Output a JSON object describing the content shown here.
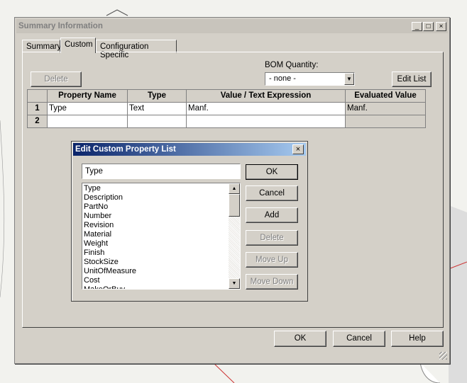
{
  "window": {
    "title": "Summary Information",
    "controls": {
      "minimize": "_",
      "maximize": "□",
      "close": "×"
    }
  },
  "tabs": [
    {
      "label": "Summary",
      "active": false
    },
    {
      "label": "Custom",
      "active": true
    },
    {
      "label": "Configuration Specific",
      "active": false
    }
  ],
  "toolbar": {
    "delete_label": "Delete",
    "bom_label": "BOM Quantity:",
    "bom_value": "- none -",
    "edit_list_label": "Edit List"
  },
  "grid": {
    "headers": [
      "Property Name",
      "Type",
      "Value / Text Expression",
      "Evaluated Value"
    ],
    "rows": [
      {
        "num": "1",
        "cells": [
          "Type",
          "Text",
          "Manf.",
          "Manf."
        ]
      },
      {
        "num": "2",
        "cells": [
          "",
          "",
          "",
          ""
        ]
      }
    ]
  },
  "dialog": {
    "title": "Edit Custom Property List",
    "close": "×",
    "input_value": "Type",
    "list_items": [
      "Type",
      "Description",
      "PartNo",
      "Number",
      "Revision",
      "Material",
      "Weight",
      "Finish",
      "StockSize",
      "UnitOfMeasure",
      "Cost",
      "MakeOrBuy"
    ],
    "buttons": {
      "ok": "OK",
      "cancel": "Cancel",
      "add": "Add",
      "delete": "Delete",
      "move_up": "Move Up",
      "move_down": "Move Down"
    }
  },
  "footer": {
    "ok": "OK",
    "cancel": "Cancel",
    "help": "Help"
  },
  "colors": {
    "dialog_face": "#d4d0c8",
    "title_active": "#0a246a"
  }
}
